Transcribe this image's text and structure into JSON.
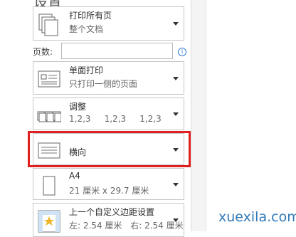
{
  "section_title": "设置",
  "print_what": {
    "title": "打印所有页",
    "subtitle": "整个文档",
    "icon": "pages-icon"
  },
  "pages": {
    "label": "页数:",
    "value": "",
    "info_icon": "i"
  },
  "sides": {
    "title": "单面打印",
    "subtitle": "只打印一侧的页面",
    "icon": "single-sided-icon"
  },
  "collate": {
    "title": "调整",
    "subtitle": "1,2,3     1,2,3     1,2,3",
    "icon": "collate-icon"
  },
  "orientation": {
    "title": "横向",
    "icon": "landscape-icon"
  },
  "paper": {
    "title": "A4",
    "subtitle": "21 厘米 x 29.7 厘米",
    "icon": "paper-size-icon"
  },
  "margins": {
    "title": "上一个自定义边距设置",
    "subtitle_left": "左: 2.54 厘米",
    "subtitle_right": "右: 2.54 厘米",
    "icon": "margins-icon"
  },
  "watermark": "xuexila.com",
  "colors": {
    "highlight": "#e0201f",
    "watermark": "#2f79b9"
  }
}
